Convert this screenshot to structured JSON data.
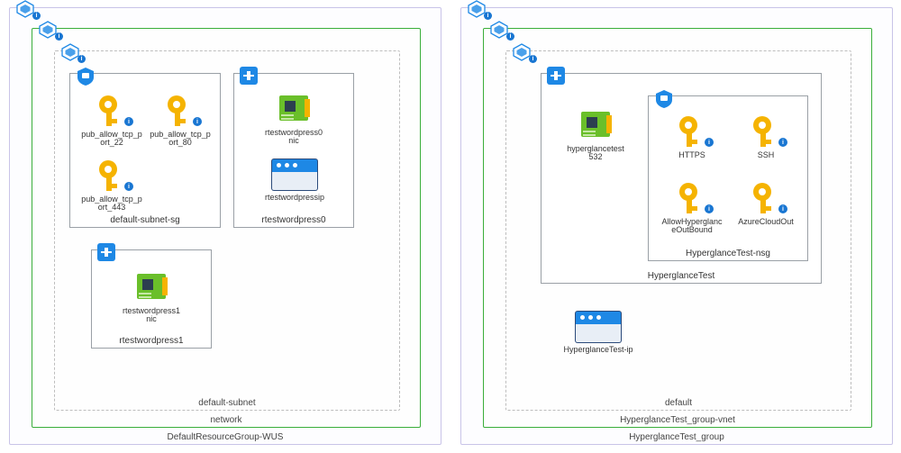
{
  "leftGroup": {
    "label": "DefaultResourceGroup-WUS",
    "vnet": {
      "label": "network",
      "subnet": {
        "label": "default-subnet",
        "nsg": {
          "label": "default-subnet-sg",
          "rules": [
            {
              "label": "pub_allow_tcp_port_22"
            },
            {
              "label": "pub_allow_tcp_port_80"
            },
            {
              "label": "pub_allow_tcp_port_443"
            }
          ]
        },
        "vm0": {
          "label": "rtestwordpress0",
          "nic": {
            "label": "rtestwordpress0nic"
          },
          "pip": {
            "label": "rtestwordpressip"
          }
        },
        "vm1": {
          "label": "rtestwordpress1",
          "nic": {
            "label": "rtestwordpress1nic"
          }
        }
      }
    }
  },
  "rightGroup": {
    "label": "HyperglanceTest_group",
    "vnet": {
      "label": "HyperglanceTest_group-vnet",
      "subnet": {
        "label": "default",
        "vm": {
          "label": "HyperglanceTest",
          "nic": {
            "label": "hyperglancetest532"
          },
          "nsg": {
            "label": "HyperglanceTest-nsg",
            "rules": [
              {
                "label": "HTTPS"
              },
              {
                "label": "SSH"
              },
              {
                "label": "AllowHyperglanceOutBound"
              },
              {
                "label": "AzureCloudOut"
              }
            ]
          }
        },
        "pip": {
          "label": "HyperglanceTest-ip"
        }
      }
    }
  }
}
